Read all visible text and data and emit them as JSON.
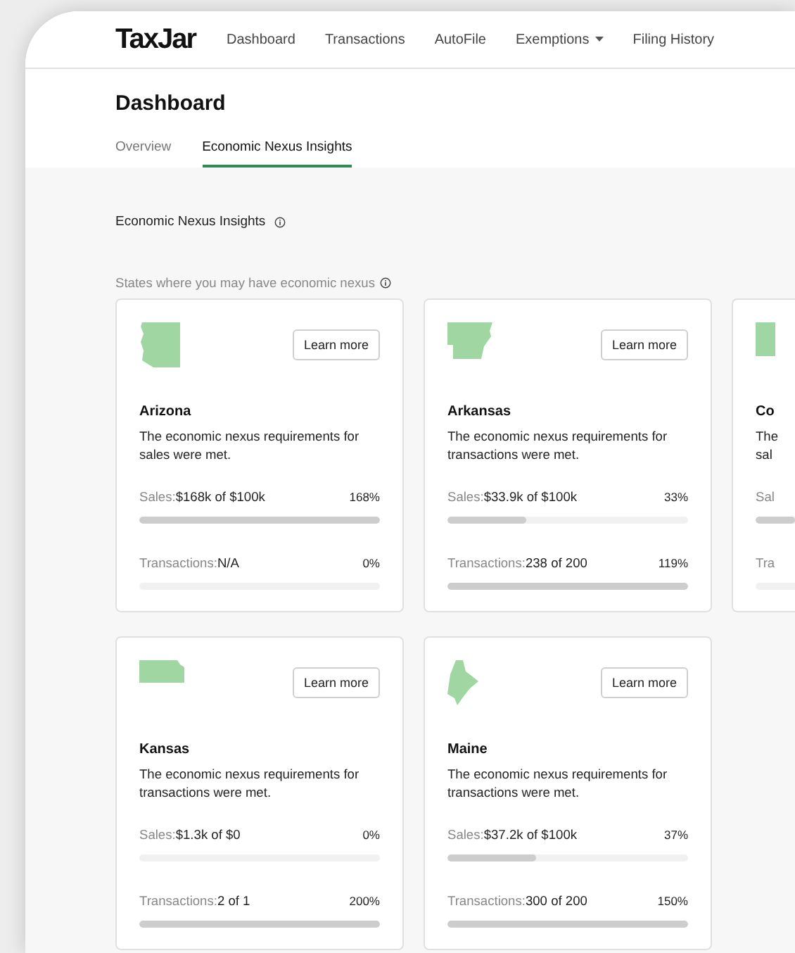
{
  "header": {
    "logo": "TaxJar",
    "nav": [
      {
        "label": "Dashboard",
        "kind": "link"
      },
      {
        "label": "Transactions",
        "kind": "link"
      },
      {
        "label": "AutoFile",
        "kind": "link"
      },
      {
        "label": "Exemptions",
        "kind": "dropdown"
      },
      {
        "label": "Filing History",
        "kind": "link"
      }
    ]
  },
  "page": {
    "title": "Dashboard",
    "tabs": [
      {
        "label": "Overview",
        "selected": false
      },
      {
        "label": "Economic Nexus Insights",
        "selected": true
      }
    ]
  },
  "section": {
    "heading": "Economic Nexus Insights",
    "subtitle": "States where you may have economic nexus"
  },
  "cards": [
    {
      "kind": "tall",
      "button": "Learn more",
      "name": "Arizona",
      "description": "The economic nexus requirements for sales were met.",
      "metrics": [
        {
          "label": "Sales:",
          "value": "$168k of $100k",
          "percent": "168%",
          "level": 1
        },
        {
          "label": "Transactions:",
          "value": "N/A",
          "percent": "0%",
          "level": 0
        }
      ]
    },
    {
      "kind": "notched",
      "button": "Learn more",
      "name": "Arkansas",
      "description": "The economic nexus requirements for transactions were met.",
      "metrics": [
        {
          "label": "Sales:",
          "value": "$33.9k of $100k",
          "percent": "33%",
          "level": 0.33
        },
        {
          "label": "Transactions:",
          "value": "238 of 200",
          "percent": "119%",
          "level": 1
        }
      ]
    },
    {
      "kind": "cut",
      "name": "Co",
      "description": "The\nsal",
      "metrics": [
        {
          "label": "Sal",
          "level": 1
        },
        {
          "label": "Tra",
          "level": 0
        }
      ]
    },
    {
      "kind": "wide",
      "button": "Learn more",
      "name": "Kansas",
      "description": "The economic nexus requirements for transactions were met.",
      "metrics": [
        {
          "label": "Sales:",
          "value": "$1.3k of $0",
          "percent": "0%",
          "level": 0
        },
        {
          "label": "Transactions:",
          "value": "2 of 1",
          "percent": "200%",
          "level": 1
        }
      ]
    },
    {
      "kind": "slim",
      "button": "Learn more",
      "name": "Maine",
      "description": "The economic nexus requirements for transactions were met.",
      "metrics": [
        {
          "label": "Sales:",
          "value": "$37.2k of $100k",
          "percent": "37%",
          "level": 0.37
        },
        {
          "label": "Transactions:",
          "value": "300 of 200",
          "percent": "150%",
          "level": 1
        }
      ]
    }
  ]
}
